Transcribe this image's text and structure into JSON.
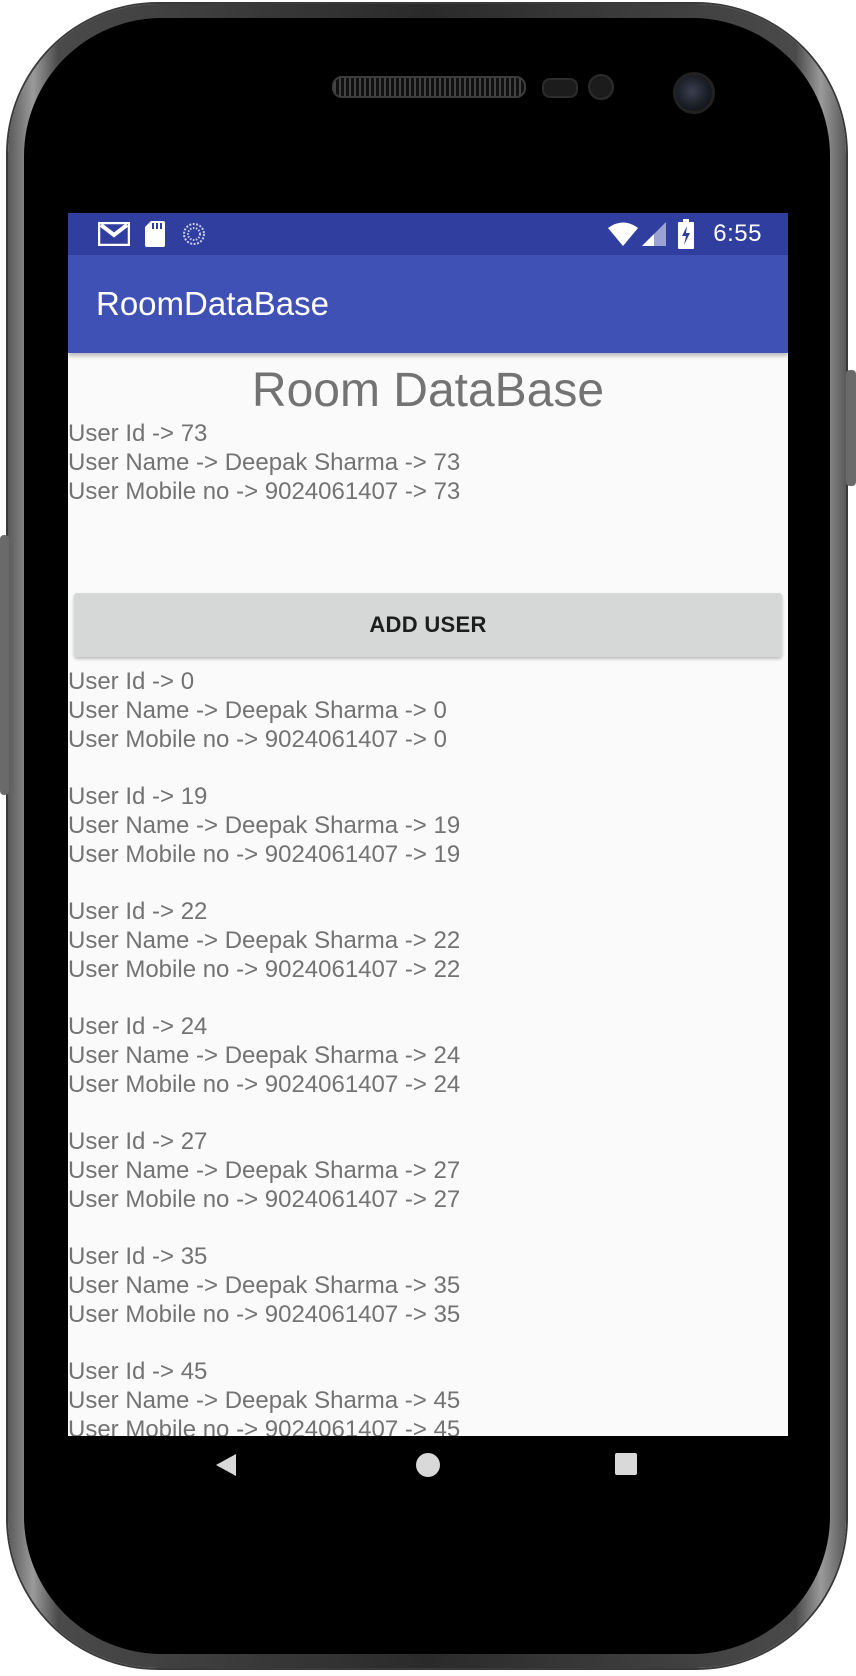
{
  "status_bar": {
    "time": "6:55",
    "left_icons": [
      "gmail-icon",
      "sd-card-icon",
      "sync-icon"
    ],
    "right_icons": [
      "wifi-icon",
      "signal-icon",
      "battery-charging-icon"
    ]
  },
  "app_bar": {
    "title": "RoomDataBase"
  },
  "main": {
    "heading": "Room DataBase",
    "current_user": {
      "id_line": "User Id -> 73",
      "name_line": "User Name -> Deepak Sharma -> 73",
      "mobile_line": "User Mobile no -> 9024061407 -> 73"
    },
    "add_button_label": "ADD USER",
    "users": [
      {
        "id_line": "User Id -> 0",
        "name_line": "User Name -> Deepak Sharma -> 0",
        "mobile_line": "User Mobile no -> 9024061407 -> 0"
      },
      {
        "id_line": "User Id -> 19",
        "name_line": "User Name -> Deepak Sharma -> 19",
        "mobile_line": "User Mobile no -> 9024061407 -> 19"
      },
      {
        "id_line": "User Id -> 22",
        "name_line": "User Name -> Deepak Sharma -> 22",
        "mobile_line": "User Mobile no -> 9024061407 -> 22"
      },
      {
        "id_line": "User Id -> 24",
        "name_line": "User Name -> Deepak Sharma -> 24",
        "mobile_line": "User Mobile no -> 9024061407 -> 24"
      },
      {
        "id_line": "User Id -> 27",
        "name_line": "User Name -> Deepak Sharma -> 27",
        "mobile_line": "User Mobile no -> 9024061407 -> 27"
      },
      {
        "id_line": "User Id -> 35",
        "name_line": "User Name -> Deepak Sharma -> 35",
        "mobile_line": "User Mobile no -> 9024061407 -> 35"
      },
      {
        "id_line": "User Id -> 45",
        "name_line": "User Name -> Deepak Sharma -> 45",
        "mobile_line": "User Mobile no -> 9024061407 -> 45"
      }
    ]
  },
  "nav_bar": {
    "icons": [
      "back-icon",
      "home-icon",
      "recents-icon"
    ]
  },
  "colors": {
    "status_bar": "#303f9f",
    "app_bar": "#3f51b5",
    "background": "#fafafa",
    "text": "#737373",
    "button": "#d6d7d7"
  }
}
